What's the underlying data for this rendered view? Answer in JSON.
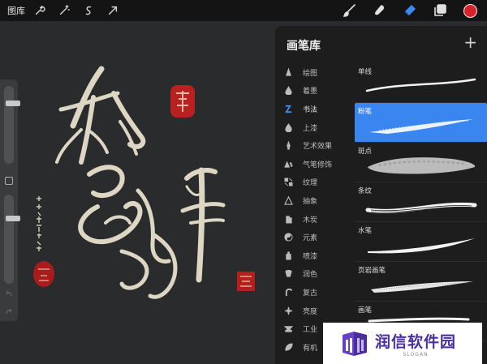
{
  "toolbar": {
    "gallery_label": "图库",
    "left_tools": [
      {
        "icon": "wrench-icon"
      },
      {
        "icon": "magic-wand-icon"
      },
      {
        "icon": "selection-icon"
      },
      {
        "icon": "transform-arrow-icon"
      }
    ],
    "right_tools": [
      {
        "icon": "brush-icon"
      },
      {
        "icon": "smudge-icon"
      },
      {
        "icon": "eraser-icon",
        "active": true
      },
      {
        "icon": "layers-icon"
      }
    ],
    "current_color": "#d8222a"
  },
  "sidebar": {
    "brush_size_level": 0.8,
    "opacity_level": 0.75
  },
  "panel": {
    "title": "画笔库",
    "add_label": "+",
    "categories": [
      {
        "label": "绘图",
        "icon": "pencil-tip-icon"
      },
      {
        "label": "着墨",
        "icon": "ink-drop-icon"
      },
      {
        "label": "书法",
        "icon": "calligraphy-icon",
        "active": true
      },
      {
        "label": "上漆",
        "icon": "paint-drop-icon"
      },
      {
        "label": "艺术效果",
        "icon": "art-brush-icon"
      },
      {
        "label": "气笔修饰",
        "icon": "airbrush-icon"
      },
      {
        "label": "纹理",
        "icon": "texture-icon"
      },
      {
        "label": "抽象",
        "icon": "triangle-icon"
      },
      {
        "label": "木炭",
        "icon": "charcoal-icon"
      },
      {
        "label": "元素",
        "icon": "yin-yang-icon"
      },
      {
        "label": "喷漆",
        "icon": "spray-can-icon"
      },
      {
        "label": "润色",
        "icon": "retouch-icon"
      },
      {
        "label": "复古",
        "icon": "retro-icon"
      },
      {
        "label": "亮度",
        "icon": "sparkle-icon"
      },
      {
        "label": "工业",
        "icon": "anvil-icon"
      },
      {
        "label": "有机",
        "icon": "leaf-icon"
      }
    ],
    "brushes": [
      {
        "name": "单线",
        "style": "mono"
      },
      {
        "name": "粉笔",
        "style": "chalk",
        "active": true
      },
      {
        "name": "斑点",
        "style": "blotch"
      },
      {
        "name": "条纹",
        "style": "stripe"
      },
      {
        "name": "水笔",
        "style": "water"
      },
      {
        "name": "页岩画笔",
        "style": "shale"
      },
      {
        "name": "画笔",
        "style": "brush"
      }
    ]
  },
  "watermark": {
    "name": "润信软件园",
    "slogan": "SLOGAN"
  }
}
